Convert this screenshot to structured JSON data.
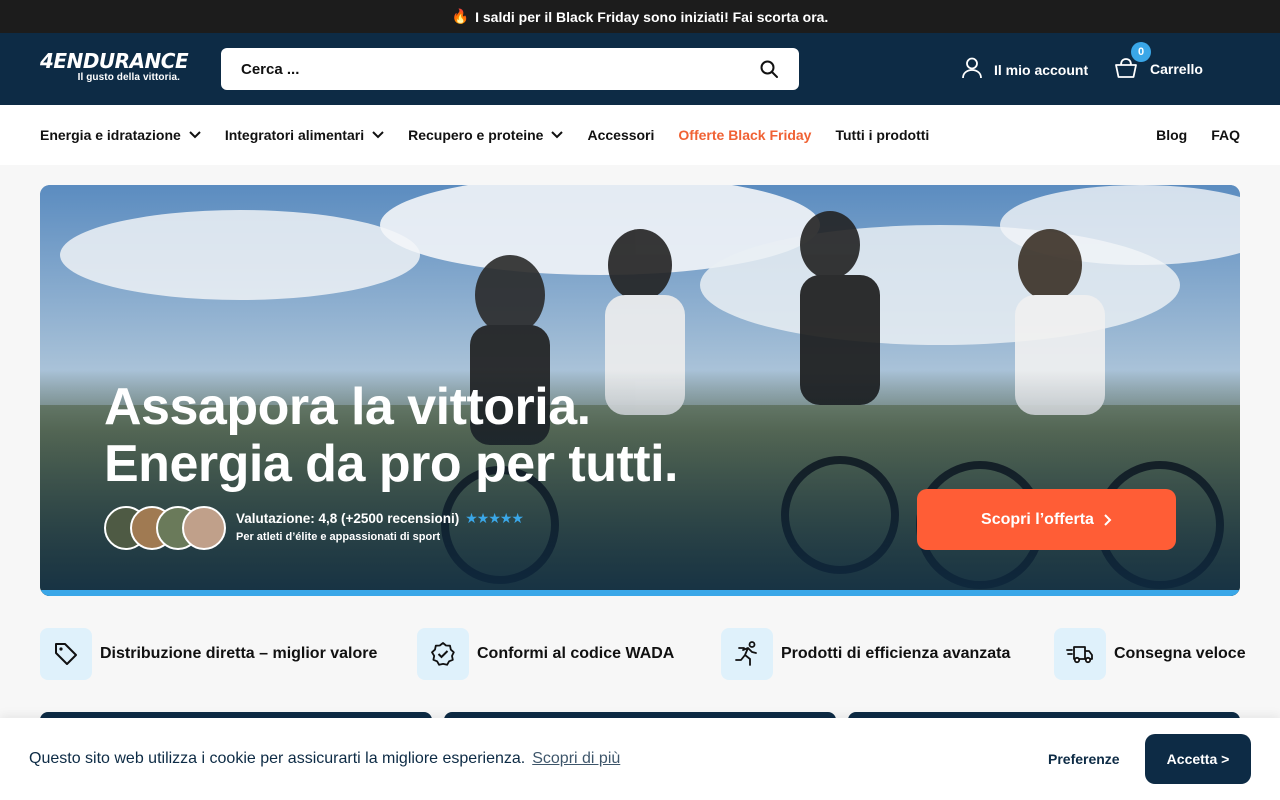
{
  "announcement": {
    "icon": "fire-icon",
    "text": "I saldi per il Black Friday sono iniziati! Fai scorta ora."
  },
  "header": {
    "logo_brand": "4ENDURANCE",
    "logo_tagline": "Il gusto della vittoria.",
    "search_placeholder": "Cerca ...",
    "account_label": "Il mio account",
    "cart_label": "Carrello",
    "cart_count": "0"
  },
  "nav": {
    "items": [
      {
        "label": "Energia e idratazione",
        "dropdown": true
      },
      {
        "label": "Integratori alimentari",
        "dropdown": true
      },
      {
        "label": "Recupero e proteine",
        "dropdown": true
      },
      {
        "label": "Accessori",
        "dropdown": false
      },
      {
        "label": "Offerte Black Friday",
        "dropdown": false
      },
      {
        "label": "Tutti i prodotti",
        "dropdown": false
      }
    ],
    "right": [
      "Blog",
      "FAQ"
    ]
  },
  "hero": {
    "headline_line1": "Assapora la vittoria.",
    "headline_line2": "Energia da pro per tutti.",
    "rating_text": "Valutazione: 4,8 (+2500 recensioni)",
    "rating_stars": "★★★★★",
    "rating_sub": "Per atleti d’élite e appassionati di sport",
    "cta_label": "Scopri l’offerta",
    "cta_icon": "chevron-right-icon"
  },
  "features": [
    {
      "icon": "tag-icon",
      "label": "Distribuzione diretta – miglior valore"
    },
    {
      "icon": "badge-check-icon",
      "label": "Conformi al codice WADA"
    },
    {
      "icon": "runner-icon",
      "label": "Prodotti di efficienza avanzata"
    },
    {
      "icon": "delivery-truck-icon",
      "label": "Consegna veloce"
    }
  ],
  "cookie": {
    "message": "Questo sito web utilizza i cookie per assicurarti la migliore esperienza.",
    "learn_more": "Scopri di più",
    "preferences": "Preferenze",
    "accept": "Accetta >"
  },
  "colors": {
    "header_bg": "#0d2b45",
    "accent_blue": "#3aa7e8",
    "cta_orange": "#ff5d36",
    "promo_text": "#f06234",
    "announce_bg": "#1c1c1c"
  }
}
